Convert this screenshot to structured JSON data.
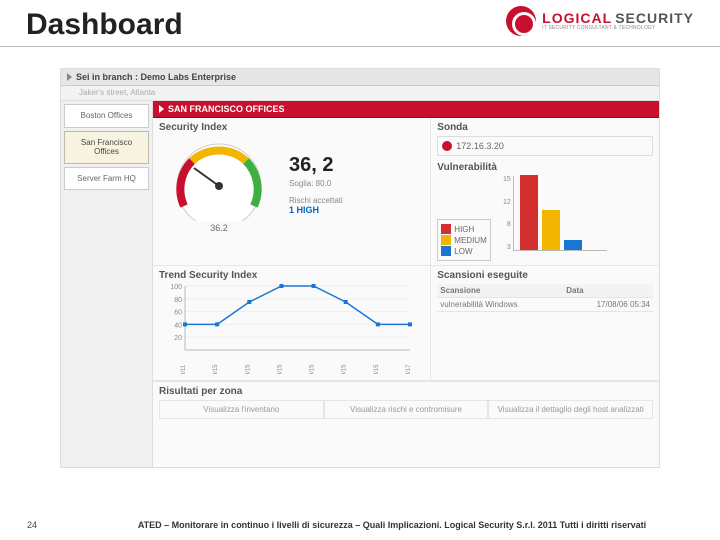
{
  "slide": {
    "title": "Dashboard",
    "page_number": "24",
    "footer": "ATED – Monitorare in continuo i livelli di sicurezza – Quali Implicazioni.  Logical Security S.r.l. 2011 Tutti i diritti riservati"
  },
  "logo": {
    "line1": "LOGICAL",
    "line2": "SECURITY",
    "tagline": "IT SECURITY CONSULTANT & TECHNOLOGY"
  },
  "branch": {
    "label": "Sei in branch : Demo Labs Enterprise",
    "sub": "Jaker's street, Atlanta"
  },
  "sidebar": {
    "items": [
      {
        "label": "Boston Offices",
        "active": false
      },
      {
        "label": "San Francisco Offices",
        "active": true
      },
      {
        "label": "Server Farm HQ",
        "active": false
      }
    ]
  },
  "office_header": "SAN FRANCISCO OFFICES",
  "security_index": {
    "title": "Security Index",
    "value": "36, 2",
    "gauge_value": "36.2",
    "threshold_label": "Soglia: 80.0",
    "risks_label": "Rischi accettati",
    "risks_value": "1 HIGH"
  },
  "sonda": {
    "title": "Sonda",
    "ip": "172.16.3.20",
    "status": "down"
  },
  "vulnerabilities": {
    "title": "Vulnerabilità",
    "legend": [
      {
        "label": "HIGH",
        "color": "#d32f2f"
      },
      {
        "label": "MEDIUM",
        "color": "#f2b500"
      },
      {
        "label": "LOW",
        "color": "#1976d2"
      }
    ]
  },
  "chart_data": [
    {
      "type": "bar",
      "id": "vulnerability-bars",
      "categories": [
        "HIGH",
        "MEDIUM",
        "LOW"
      ],
      "values": [
        15,
        8,
        2
      ],
      "colors": [
        "#d32f2f",
        "#f2b500",
        "#1976d2"
      ],
      "ylim": [
        0,
        15
      ],
      "y_ticks": [
        15,
        12,
        8,
        3
      ]
    },
    {
      "type": "line",
      "id": "trend-security-index",
      "title": "Trend Security Index",
      "x": [
        "08/11",
        "08/15",
        "08/15",
        "08/15",
        "09/15",
        "09/15",
        "09/15",
        "09/17"
      ],
      "values": [
        40,
        40,
        75,
        100,
        100,
        75,
        40,
        40
      ],
      "ylim": [
        0,
        100
      ],
      "y_ticks": [
        100,
        80,
        60,
        40,
        20
      ]
    }
  ],
  "scans": {
    "title": "Scansioni eseguite",
    "headers": [
      "Scansione",
      "Data"
    ],
    "rows": [
      {
        "name": "vulnerabilità Windows",
        "date": "17/08/06 05:34"
      }
    ]
  },
  "results": {
    "title": "Risultati per zona",
    "links": [
      "Visualizza l'inventario",
      "Visualizza rischi e contromisure",
      "Visualizza il dettaglio degli host analizzati"
    ]
  }
}
